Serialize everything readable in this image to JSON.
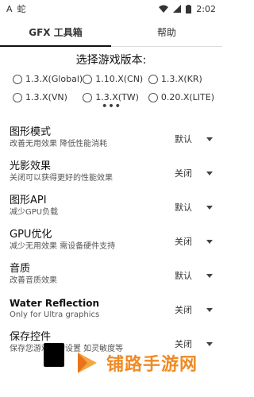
{
  "status": {
    "icon1": "A",
    "icon2": "蛇",
    "time": "2:02"
  },
  "tabs": [
    {
      "label": "GFX 工具箱"
    },
    {
      "label": "帮助"
    }
  ],
  "version": {
    "title": "选择游戏版本:",
    "options": [
      "1.3.X(Global)",
      "1.10.X(CN)",
      "1.3.X(KR)",
      "1.3.X(VN)",
      "1.3.X(TW)",
      "0.20.X(LITE)"
    ]
  },
  "more": "•••",
  "settings": [
    {
      "title": "图形模式",
      "sub": "改善无用效果 降低性能消耗",
      "value": "默认"
    },
    {
      "title": "光影效果",
      "sub": "关闭可以获得更好的性能效果",
      "value": "关闭"
    },
    {
      "title": "图形API",
      "sub": "减少GPU负载",
      "value": "默认"
    },
    {
      "title": "GPU优化",
      "sub": "减少无用效果 需设备硬件支持",
      "value": "关闭"
    },
    {
      "title": "音质",
      "sub": "改善音质效果",
      "value": "默认"
    },
    {
      "title": "Water Reflection",
      "sub": "Only for Ultra graphics",
      "value": "关闭"
    },
    {
      "title": "保存控件",
      "sub": "保存您游戏中的设置 如灵敏度等",
      "value": "关闭"
    }
  ],
  "watermark": "铺路手游网"
}
